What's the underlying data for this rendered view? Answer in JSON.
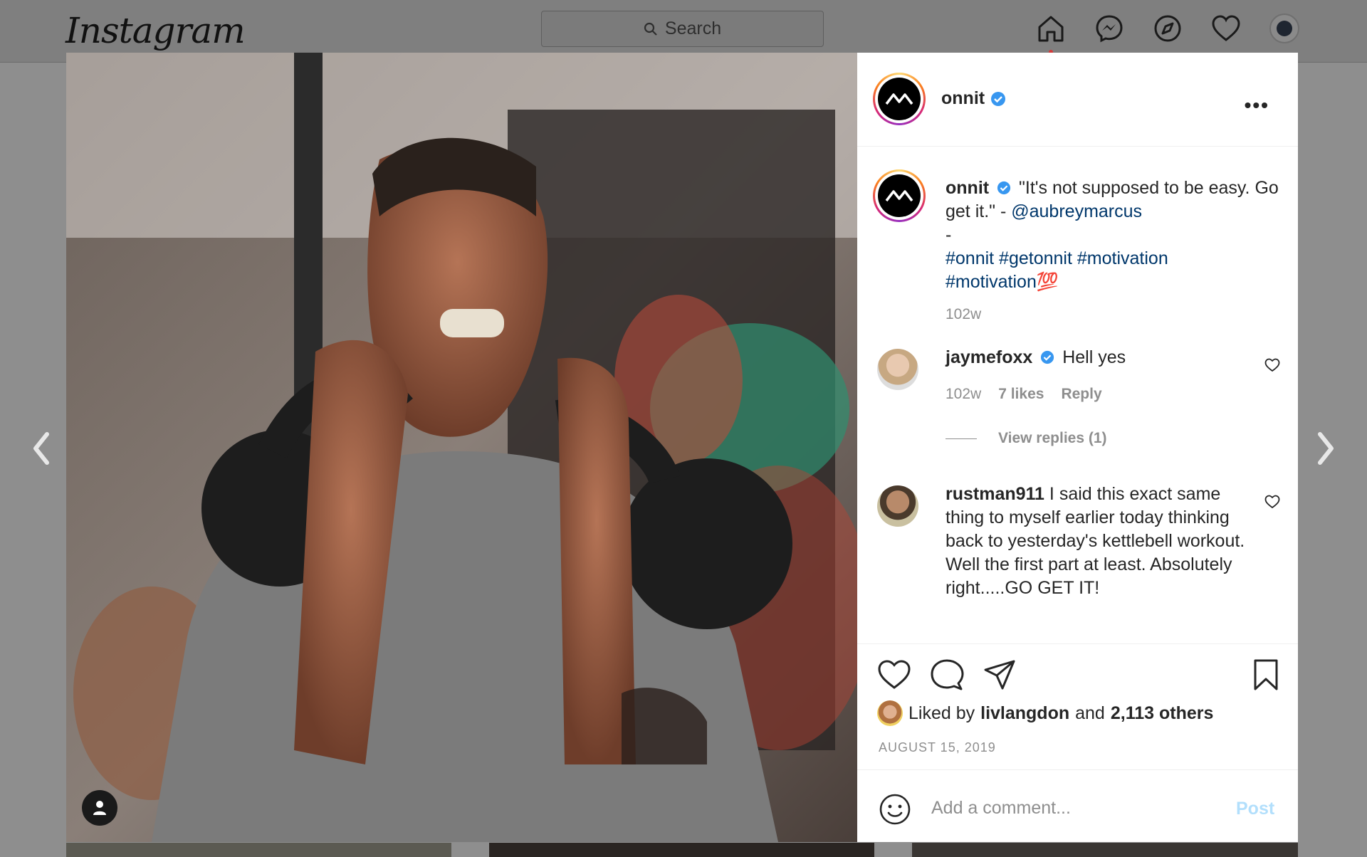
{
  "app": {
    "logo": "Instagram"
  },
  "search": {
    "placeholder": "Search"
  },
  "nav": {
    "icons": [
      "home-icon",
      "messenger-icon",
      "explore-icon",
      "heart-icon",
      "profile-avatar"
    ]
  },
  "post": {
    "account": "onnit",
    "verified": true,
    "caption": {
      "username": "onnit",
      "text_before_mention": "\"It's not supposed to be easy. Go get it.\" - ",
      "mention": "@aubreymarcus",
      "dash": "-",
      "hashtags_line1": "#onnit #getonnit #motivation",
      "hashtags_line2": "#motivation",
      "emoji": "💯",
      "time": "102w"
    },
    "comments": [
      {
        "username": "jaymefoxx",
        "verified": true,
        "text": "Hell yes",
        "time": "102w",
        "likes": "7 likes",
        "reply": "Reply",
        "view_replies": "View replies (1)"
      },
      {
        "username": "rustman911",
        "verified": false,
        "text": "I said this exact same thing to myself earlier today thinking back to yesterday's kettlebell workout. Well the first part at least. Absolutely right.....GO GET IT!"
      }
    ],
    "liked_by_prefix": "Liked by",
    "liked_by_user": "livlangdon",
    "liked_by_and": "and",
    "liked_by_others": "2,113 others",
    "date": "AUGUST 15, 2019",
    "comment_placeholder": "Add a comment...",
    "post_button": "Post"
  },
  "colors": {
    "link": "#00376b",
    "verified": "#3897f0",
    "post_disabled": "#b2dffc"
  }
}
